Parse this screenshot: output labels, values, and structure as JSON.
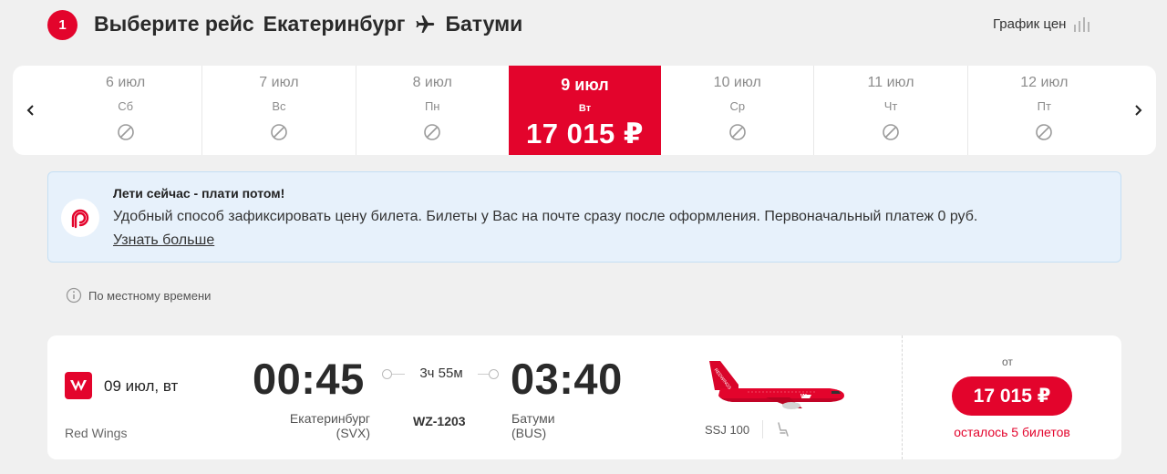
{
  "header": {
    "step": "1",
    "title_prefix": "Выберите рейс",
    "origin": "Екатеринбург",
    "destination": "Батуми",
    "price_chart_label": "График цен"
  },
  "date_strip": {
    "days": [
      {
        "date": "6 июл",
        "dow": "Сб",
        "available": false
      },
      {
        "date": "7 июл",
        "dow": "Вс",
        "available": false
      },
      {
        "date": "8 июл",
        "dow": "Пн",
        "available": false
      },
      {
        "date": "9 июл",
        "dow": "Вт",
        "price": "17 015 ₽",
        "available": true,
        "selected": true
      },
      {
        "date": "10 июл",
        "dow": "Ср",
        "available": false
      },
      {
        "date": "11 июл",
        "dow": "Чт",
        "available": false
      },
      {
        "date": "12 июл",
        "dow": "Пт",
        "available": false
      }
    ]
  },
  "promo": {
    "title": "Лети сейчас - плати потом!",
    "text": "Удобный способ зафиксировать цену билета. Билеты у Вас на почте сразу после оформления. Первоначальный платеж 0 руб.",
    "link": "Узнать больше"
  },
  "local_time_note": "По местному времени",
  "flight": {
    "date": "09 июл, вт",
    "airline": "Red Wings",
    "dep_time": "00:45",
    "arr_time": "03:40",
    "duration": "3ч 55м",
    "flight_number": "WZ-1203",
    "dep_city": "Екатеринбург",
    "dep_code": "(SVX)",
    "arr_city": "Батуми",
    "arr_code": "(BUS)",
    "aircraft": "SSJ 100",
    "price_from": "от",
    "price": "17 015 ₽",
    "seats_left": "осталось 5 билетов"
  },
  "colors": {
    "accent": "#e3042c",
    "promo_bg": "#e7f1fb"
  }
}
